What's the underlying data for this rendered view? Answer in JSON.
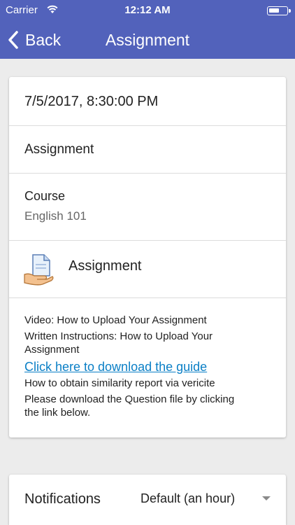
{
  "status_bar": {
    "carrier": "Carrier",
    "time": "12:12 AM",
    "battery_level": 0.6
  },
  "nav": {
    "back_label": "Back",
    "title": "Assignment"
  },
  "assignment": {
    "date": "7/5/2017, 8:30:00 PM",
    "name": "Assignment",
    "course_label": "Course",
    "course_value": "English 101",
    "module_name": "Assignment",
    "description": {
      "line1": "Video: How to Upload Your Assignment",
      "line2a": "Written Instructions: How to Upload Your",
      "line2b": "Assignment",
      "link": "Click here to download the guide",
      "line3": "How to obtain similarity report via vericite",
      "line4a": "Please download the Question file by clicking",
      "line4b": "the link below."
    }
  },
  "notifications": {
    "label": "Notifications",
    "value": "Default (an hour)"
  },
  "colors": {
    "header": "#5262bb",
    "link": "#0a7fc6",
    "background": "#ececec"
  }
}
